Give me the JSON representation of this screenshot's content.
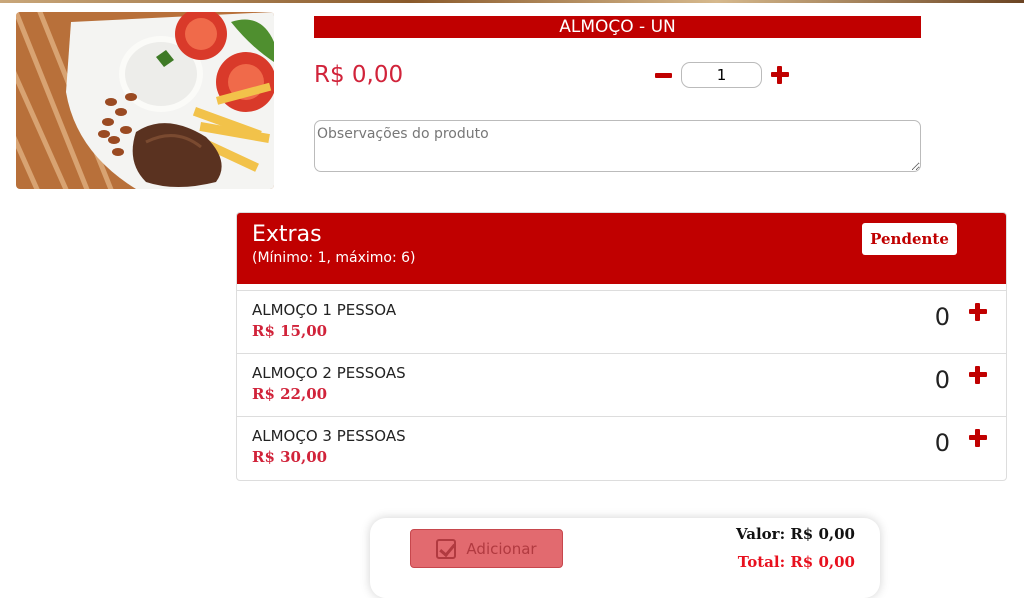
{
  "product": {
    "title": "ALMOÇO - UN",
    "price": "R$ 0,00",
    "quantity": "1",
    "observations_placeholder": "Observações do produto"
  },
  "extras": {
    "title": "Extras",
    "subtitle": "(Mínimo: 1, máximo: 6)",
    "status_badge": "Pendente",
    "items": [
      {
        "name": "ALMOÇO 1 PESSOA",
        "price": "R$ 15,00",
        "count": "0"
      },
      {
        "name": "ALMOÇO 2 PESSOAS",
        "price": "R$ 22,00",
        "count": "0"
      },
      {
        "name": "ALMOÇO 3 PESSOAS",
        "price": "R$ 30,00",
        "count": "0"
      }
    ]
  },
  "footer": {
    "add_label": "Adicionar",
    "valor": "Valor: R$ 0,00",
    "total": "Total: R$ 0,00"
  },
  "colors": {
    "accent": "#c00000",
    "price": "#d1233a",
    "total": "#e8101e",
    "add_button_disabled": "#e26a6f"
  },
  "icons": [
    "minus-icon",
    "plus-icon",
    "check-square-icon"
  ]
}
